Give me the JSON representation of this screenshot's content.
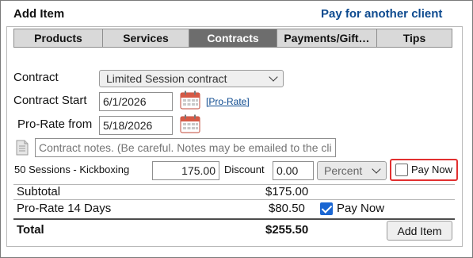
{
  "header": {
    "title": "Add Item",
    "pay_other_link": "Pay for another client"
  },
  "tabs": [
    {
      "label": "Products",
      "active": false
    },
    {
      "label": "Services",
      "active": false
    },
    {
      "label": "Contracts",
      "active": true
    },
    {
      "label": "Payments/Gift…",
      "active": false
    },
    {
      "label": "Tips",
      "active": false
    }
  ],
  "form": {
    "contract_label": "Contract",
    "contract_value": "Limited Session contract",
    "contract_start_label": "Contract Start",
    "contract_start_value": "6/1/2026",
    "pro_rate_link": "[Pro-Rate]",
    "pro_rate_from_label": "Pro-Rate from",
    "pro_rate_from_value": "5/18/2026",
    "notes_placeholder": "Contract notes. (Be careful. Notes may be emailed to the client.)",
    "item_label": "50 Sessions - Kickboxing",
    "item_price": "175.00",
    "discount_label": "Discount",
    "discount_value": "0.00",
    "discount_type": "Percent",
    "pay_now_label": "Pay Now",
    "pay_now_checked": false
  },
  "summary": {
    "subtotal_label": "Subtotal",
    "subtotal_value": "$175.00",
    "prorate_label": "Pro-Rate 14 Days",
    "prorate_value": "$80.50",
    "prorate_pay_now_label": "Pay Now",
    "prorate_pay_now_checked": true,
    "total_label": "Total",
    "total_value": "$255.50",
    "add_item_button": "Add Item"
  },
  "colors": {
    "link": "#0d4a8f",
    "active_tab": "#6d6d6d",
    "highlight": "#e23030",
    "checkbox_checked": "#1a66d2"
  }
}
